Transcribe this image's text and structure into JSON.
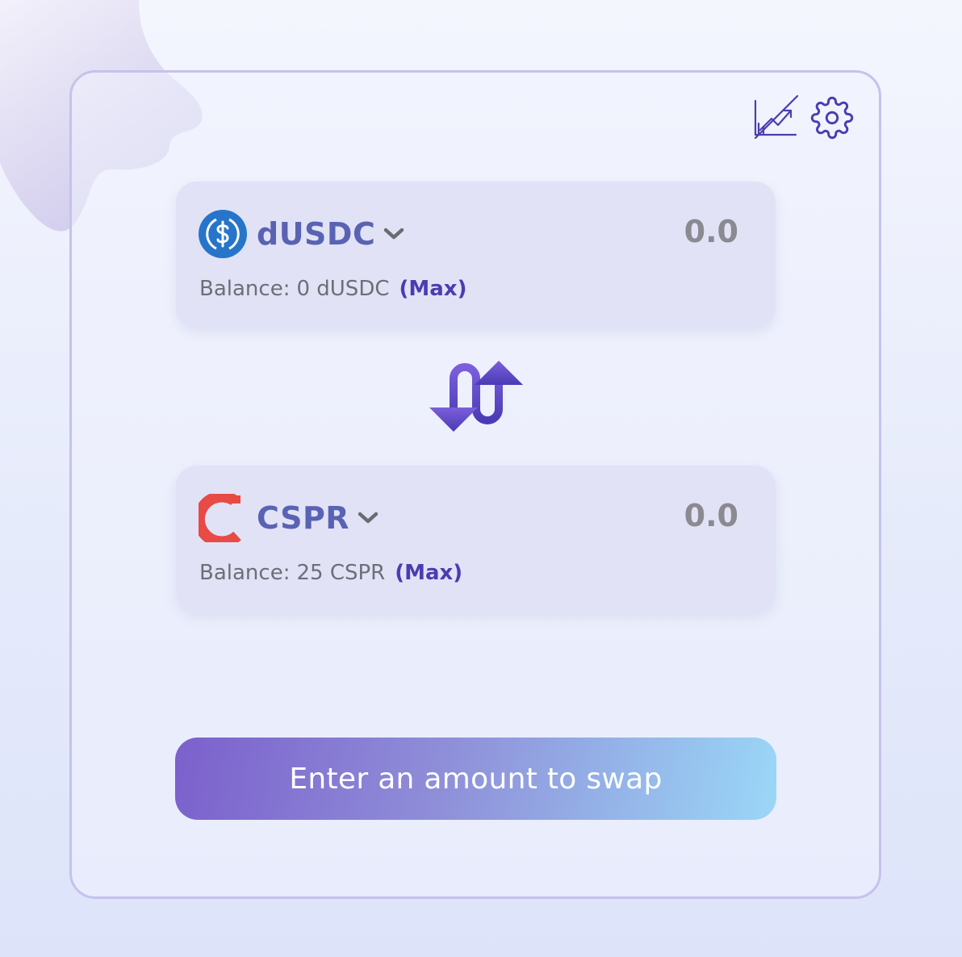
{
  "colors": {
    "accent": "#4b3db0",
    "token_text": "#5a62b3",
    "card_border": "#c5c2ec",
    "panel_bg": "#e1e2f6",
    "button_gradient_start": "#7b60cc",
    "button_gradient_end": "#9ad7f7",
    "usdc_blue": "#2775ca",
    "cspr_red": "#e84a45"
  },
  "toolbar": {
    "chart_icon": "chart-hidden-icon",
    "settings_icon": "gear-icon"
  },
  "from_token": {
    "icon": "usdc-logo",
    "symbol": "dUSDC",
    "amount": "0.0",
    "balance_label": "Balance:",
    "balance_value": "0 dUSDC",
    "max_label": "(Max)"
  },
  "to_token": {
    "icon": "cspr-logo",
    "symbol": "CSPR",
    "amount": "0.0",
    "balance_label": "Balance:",
    "balance_value": "25 CSPR",
    "max_label": "(Max)"
  },
  "swap_direction_icon": "swap-arrows-icon",
  "action_button": {
    "label": "Enter an amount to swap"
  }
}
